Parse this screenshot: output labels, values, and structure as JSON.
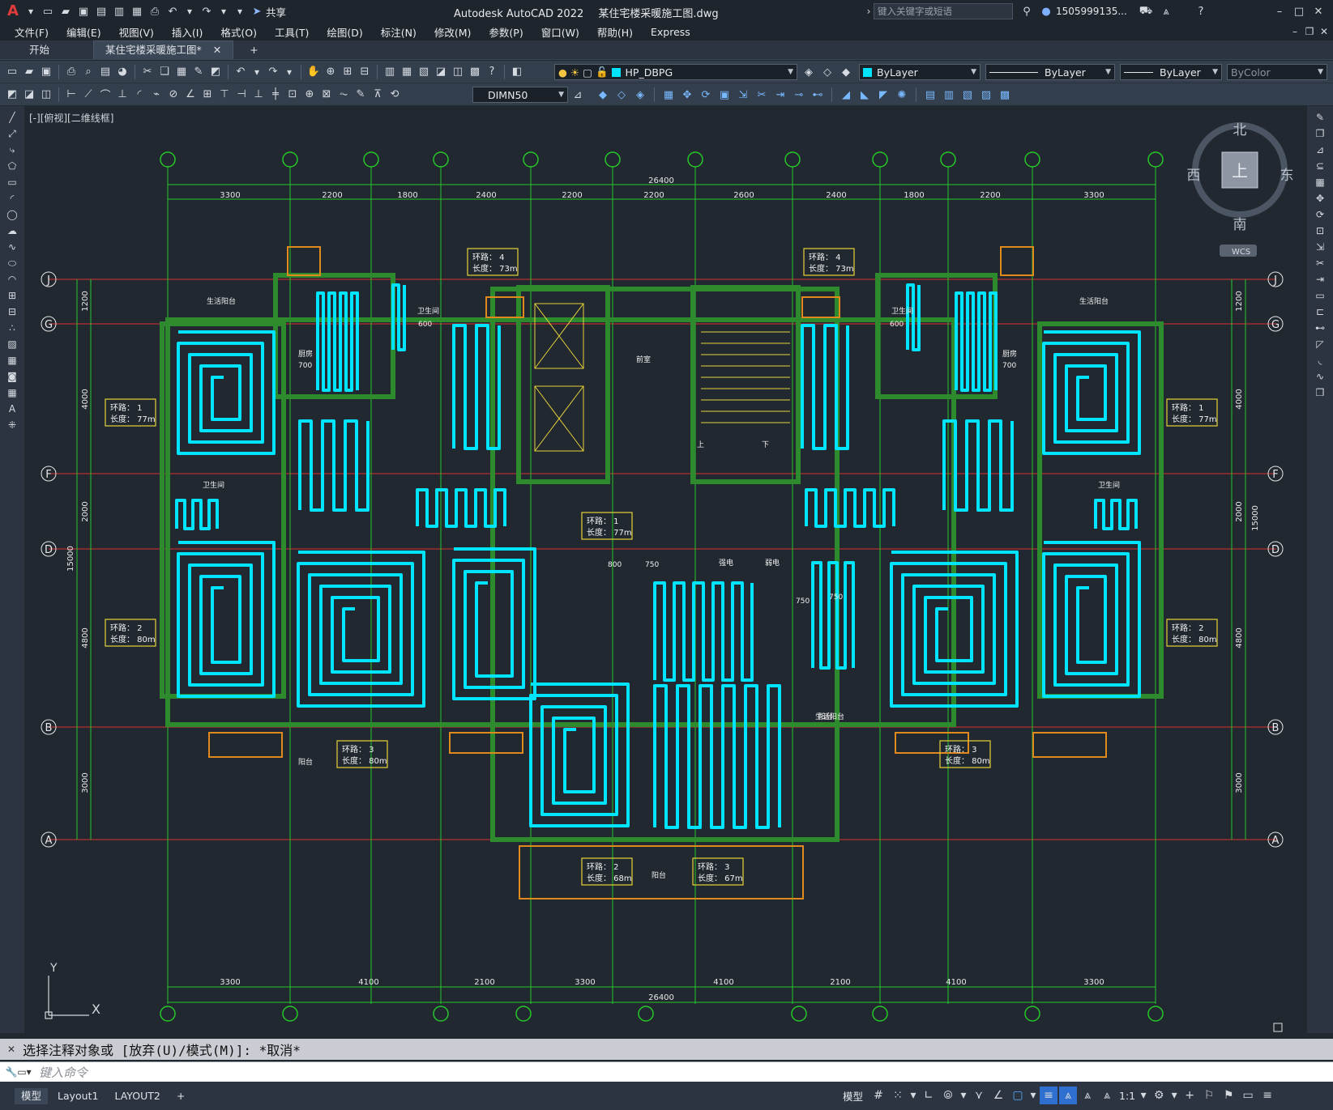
{
  "app": {
    "title": "Autodesk AutoCAD 2022",
    "file_name": "某住宅楼采暖施工图.dwg",
    "share_label": "共享",
    "search_placeholder": "键入关键字或短语",
    "user": "1505999135...",
    "logo": "A"
  },
  "menu": [
    "文件(F)",
    "编辑(E)",
    "视图(V)",
    "插入(I)",
    "格式(O)",
    "工具(T)",
    "绘图(D)",
    "标注(N)",
    "修改(M)",
    "参数(P)",
    "窗口(W)",
    "帮助(H)",
    "Express"
  ],
  "tabs": [
    {
      "label": "开始"
    },
    {
      "label": "某住宅楼采暖施工图*"
    }
  ],
  "toolbar": {
    "layer": "HP_DBPG",
    "color": "ByLayer",
    "linetype": "ByLayer",
    "lineweight": "ByLayer",
    "plotstyle": "ByColor",
    "dimstyle": "DIMN50"
  },
  "view_label": "[-][俯视][二维线框]",
  "viewcube": {
    "north": "北",
    "south": "南",
    "east": "东",
    "west": "西",
    "face": "上",
    "wcs": "WCS"
  },
  "drawing": {
    "axes_top": [
      "",
      ""
    ],
    "row_axes": [
      "J",
      "G",
      "F",
      "D",
      "B",
      "A"
    ],
    "top_dims": [
      "3300",
      "2200",
      "1800",
      "2400",
      "2200",
      "2200",
      "2600",
      "2400",
      "1800",
      "2200",
      "3300"
    ],
    "top_total": "26400",
    "bottom_dims": [
      "3300",
      "4100",
      "2100",
      "3300",
      "4100",
      "2100",
      "4100",
      "3300"
    ],
    "bottom_total": "26400",
    "left_dims": [
      "1200",
      "4000",
      "2000",
      "4800",
      "3000"
    ],
    "left_total": "15000",
    "right_dims": [
      "1200",
      "4000",
      "2000",
      "4800",
      "3000"
    ],
    "right_total": "15000",
    "loop_tags": [
      {
        "loop": "环路： 4",
        "length": "长度： 73m"
      },
      {
        "loop": "环路： 4",
        "length": "长度： 73m"
      },
      {
        "loop": "环路： 1",
        "length": "长度： 77m"
      },
      {
        "loop": "环路： 1",
        "length": "长度： 77m"
      },
      {
        "loop": "环路： 1",
        "length": "长度： 77m"
      },
      {
        "loop": "环路： 2",
        "length": "长度： 80m"
      },
      {
        "loop": "环路： 2",
        "length": "长度： 80m"
      },
      {
        "loop": "环路： 3",
        "length": "长度： 80m"
      },
      {
        "loop": "环路： 3",
        "length": "长度： 80m"
      },
      {
        "loop": "环路： 2",
        "length": "长度： 68m"
      },
      {
        "loop": "环路： 3",
        "length": "长度： 67m"
      }
    ],
    "room_labels": [
      "生活阳台",
      "生活阳台",
      "卫生间",
      "卫生间",
      "卫生间",
      "卫生间",
      "厨房",
      "厨房",
      "前室",
      "阳台",
      "阳台",
      "阳台",
      "生活阳台",
      "上",
      "下",
      "强电",
      "弱电"
    ],
    "small_dims": [
      "600",
      "700",
      "600",
      "700",
      "750",
      "750",
      "750",
      "800"
    ],
    "ucs": {
      "x": "X",
      "y": "Y"
    }
  },
  "command": {
    "history": "选择注释对象或 [放弃(U)/模式(M)]: *取消*",
    "placeholder": "键入命令"
  },
  "status": {
    "layout_tabs": [
      "模型",
      "Layout1",
      "LAYOUT2"
    ],
    "model_label": "模型",
    "scale": "1:1"
  }
}
